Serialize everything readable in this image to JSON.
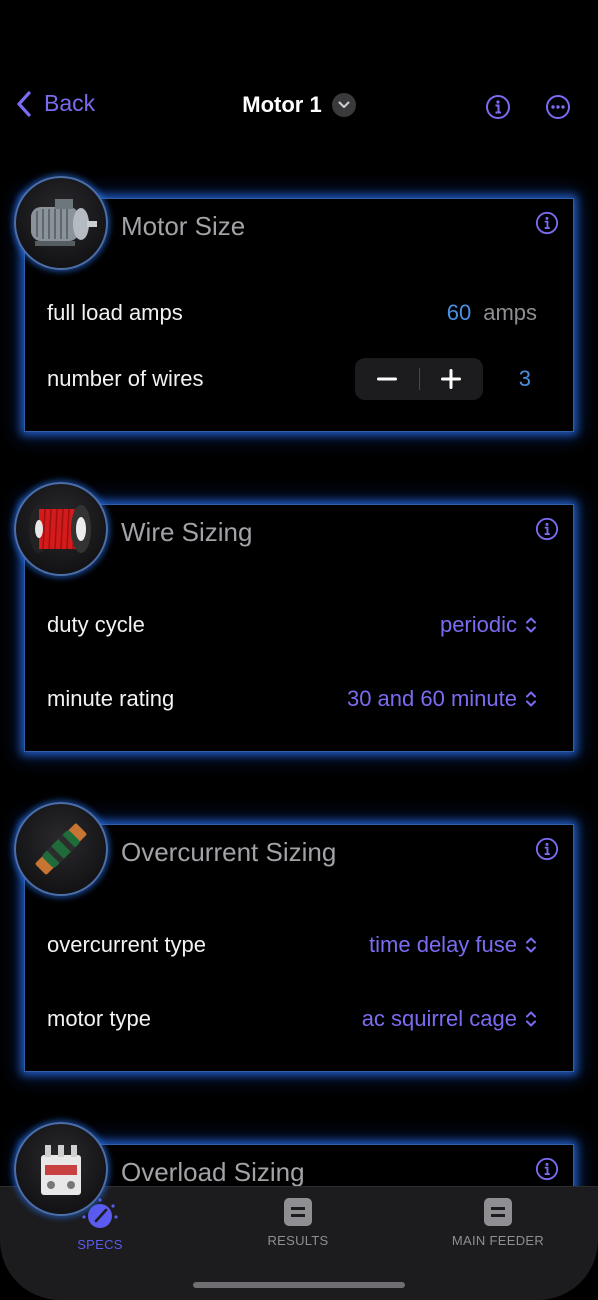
{
  "nav": {
    "back_label": "Back",
    "title": "Motor 1"
  },
  "cards": {
    "motor_size": {
      "title": "Motor Size",
      "full_load_amps_label": "full load amps",
      "full_load_amps_value": "60",
      "full_load_amps_unit": "amps",
      "number_of_wires_label": "number of wires",
      "number_of_wires_value": "3"
    },
    "wire_sizing": {
      "title": "Wire Sizing",
      "duty_cycle_label": "duty cycle",
      "duty_cycle_value": "periodic",
      "minute_rating_label": "minute rating",
      "minute_rating_value": "30 and 60 minute"
    },
    "overcurrent_sizing": {
      "title": "Overcurrent Sizing",
      "overcurrent_type_label": "overcurrent type",
      "overcurrent_type_value": "time delay fuse",
      "motor_type_label": "motor type",
      "motor_type_value": "ac squirrel cage"
    },
    "overload_sizing": {
      "title": "Overload Sizing"
    }
  },
  "tabs": [
    {
      "label": "SPECS",
      "icon": "gauge-icon",
      "selected": true
    },
    {
      "label": "RESULTS",
      "icon": "equals-icon",
      "selected": false
    },
    {
      "label": "MAIN FEEDER",
      "icon": "equals-icon",
      "selected": false
    }
  ],
  "colors": {
    "accent": "#7a6cf0",
    "value_blue": "#4a90e2",
    "card_glow": "#2a6ee6",
    "tab_selected": "#5b5bf0",
    "tab_unselected": "#8e8e93"
  }
}
